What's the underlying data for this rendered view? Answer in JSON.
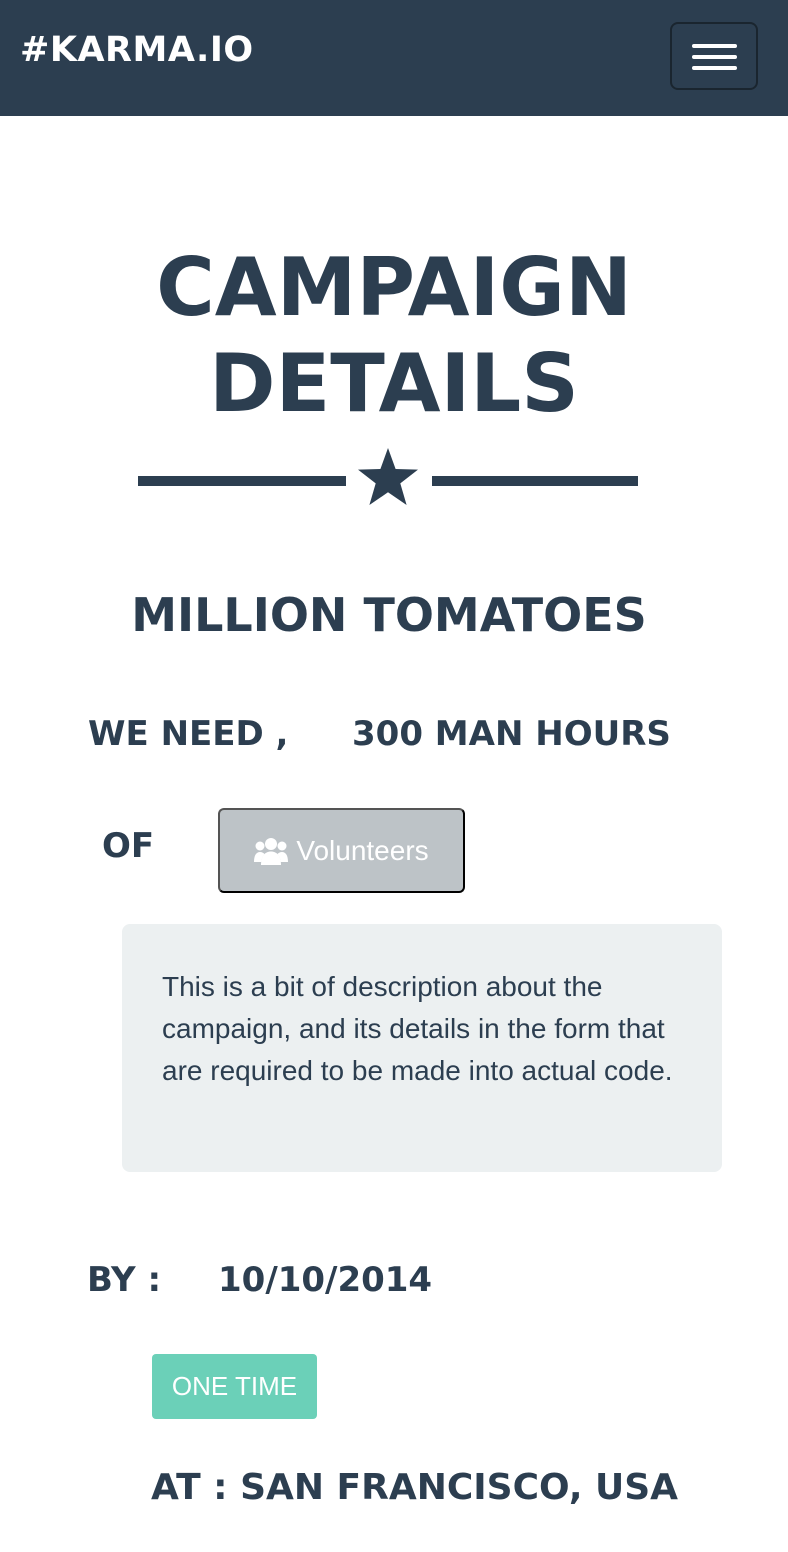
{
  "navbar": {
    "brand": "#KARMA.IO",
    "menu_icon": "hamburger-menu-icon"
  },
  "header": {
    "title_line1": "CAMPAIGN",
    "title_line2": "DETAILS",
    "divider_icon": "star-icon"
  },
  "campaign": {
    "name": "MILLION TOMATOES",
    "need_label": "WE NEED ,",
    "need_value": "300 MAN HOURS",
    "of_label": "OF",
    "type_button": {
      "icon": "users-icon",
      "label": "Volunteers"
    },
    "description": "This is a bit of description about the campaign, and its details in the form that are required to be made into actual code.",
    "by_label": "BY :",
    "by_value": "10/10/2014",
    "frequency": "ONE TIME",
    "location": "AT : SAN FRANCISCO, USA"
  },
  "colors": {
    "primary": "#2c3e50",
    "badge": "#6bd0b8",
    "button": "#bdc3c7",
    "panel": "#ecf0f1"
  }
}
